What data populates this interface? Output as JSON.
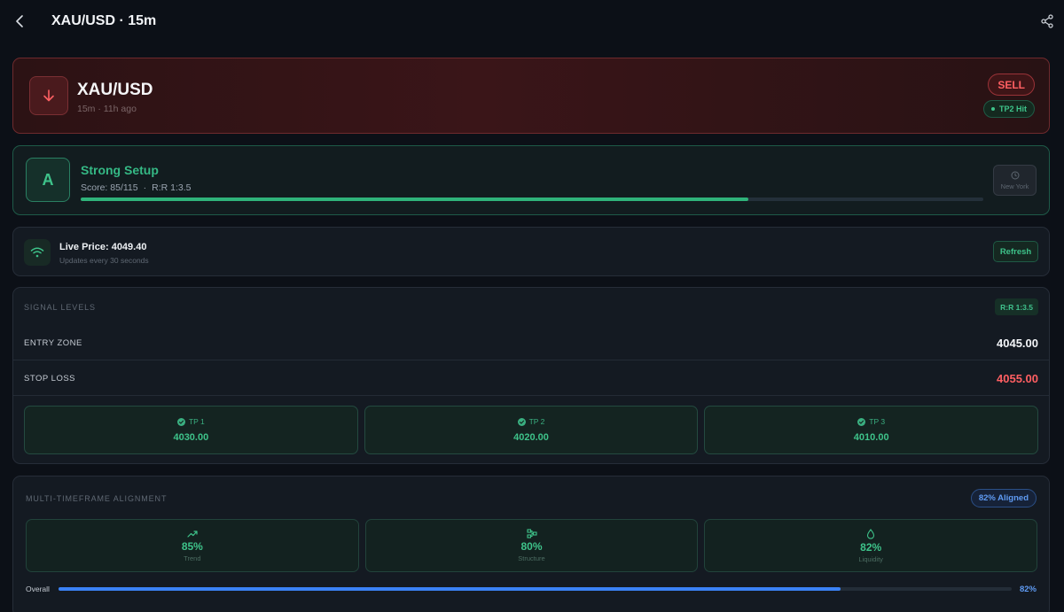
{
  "header": {
    "title": "XAU/USD · 15m"
  },
  "signal": {
    "symbol": "XAU/USD",
    "meta": "15m · 11h ago",
    "direction": "SELL",
    "status": "TP2 Hit"
  },
  "grade": {
    "letter": "A",
    "title": "Strong Setup",
    "score": "Score: 85/115",
    "separator": "·",
    "rr": "R:R 1:3.5",
    "progress": 0.74,
    "session": "New York"
  },
  "live": {
    "price_text": "Live Price: 4049.40",
    "subtitle": "Updates every 30 seconds",
    "refresh_label": "Refresh"
  },
  "levels": {
    "section_title": "SIGNAL LEVELS",
    "rr_chip": "R:R 1:3.5",
    "entry_label": "ENTRY ZONE",
    "entry_value": "4045.00",
    "stop_label": "STOP LOSS",
    "stop_value": "4055.00",
    "targets": [
      {
        "label": "TP 1",
        "value": "4030.00"
      },
      {
        "label": "TP 2",
        "value": "4020.00"
      },
      {
        "label": "TP 3",
        "value": "4010.00"
      }
    ]
  },
  "mtf": {
    "section_title": "MULTI-TIMEFRAME ALIGNMENT",
    "aligned_chip": "82% Aligned",
    "items": [
      {
        "value": "85%",
        "label": "Trend",
        "icon": "trend-icon"
      },
      {
        "value": "80%",
        "label": "Structure",
        "icon": "structure-icon"
      },
      {
        "value": "82%",
        "label": "Liquidity",
        "icon": "liquidity-icon"
      }
    ],
    "overall_label": "Overall",
    "overall_value": "82%",
    "overall_progress": 0.82
  },
  "colors": {
    "sell": "#ff5f62",
    "success": "#3ec38a",
    "accent_blue": "#3b82f6",
    "white_value": "#f3f5f8"
  }
}
